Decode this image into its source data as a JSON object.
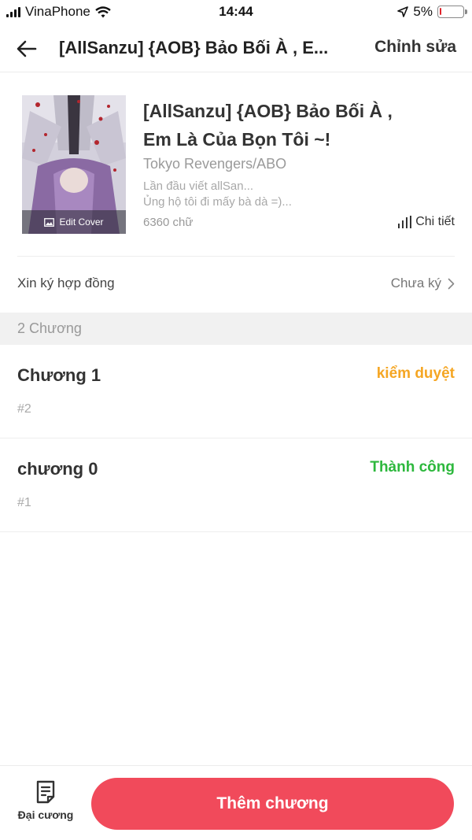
{
  "status_bar": {
    "carrier": "VinaPhone",
    "time": "14:44",
    "battery": "5%",
    "battery_level": 0.05,
    "icons": [
      "signal-icon",
      "wifi-icon",
      "location-arrow-icon",
      "battery-icon"
    ]
  },
  "nav": {
    "title": "[AllSanzu] {AOB} Bảo Bối À , E...",
    "edit_label": "Chỉnh sửa",
    "back_icon": "arrow-left-icon"
  },
  "book": {
    "title_line1": "[AllSanzu] {AOB} Bảo Bối À ,",
    "title_line2": "Em Là Của Bọn Tôi ~!",
    "category": "Tokyo Revengers/ABO",
    "desc_line1": "Lần đầu viết allSan...",
    "desc_line2": "Ủng hộ tôi đi mấy bà dà =)...",
    "word_count": "6360 chữ",
    "detail_label": "Chi tiết",
    "edit_cover_label": "Edit Cover"
  },
  "contract": {
    "label": "Xin ký hợp đồng",
    "status": "Chưa ký"
  },
  "chapters_header": "2 Chương",
  "chapters": [
    {
      "title": "Chương 1",
      "status": "kiểm duyệt",
      "status_color": "#f5a623",
      "number": "#2"
    },
    {
      "title": "chương 0",
      "status": "Thành công",
      "status_color": "#2db83d",
      "number": "#1"
    }
  ],
  "bottom": {
    "outline_label": "Đại cương",
    "add_chapter_label": "Thêm chương"
  },
  "colors": {
    "accent": "#f14a5b",
    "pending": "#f5a623",
    "success": "#2db83d"
  }
}
